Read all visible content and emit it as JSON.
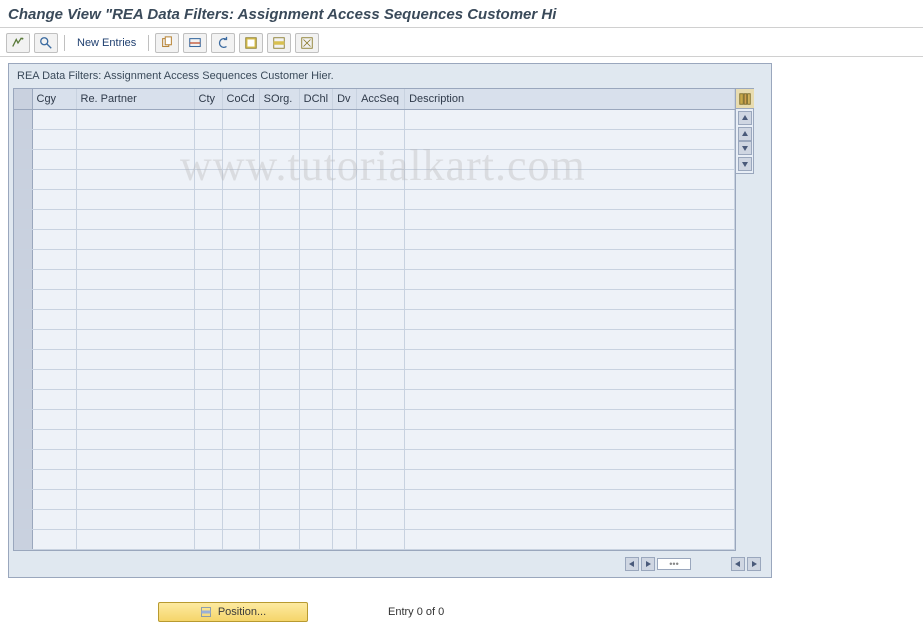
{
  "title": "Change View \"REA Data Filters: Assignment Access Sequences Customer Hi",
  "toolbar": {
    "new_entries_label": "New Entries"
  },
  "panel": {
    "title": "REA Data Filters: Assignment Access Sequences Customer Hier."
  },
  "columns": {
    "cgy": "Cgy",
    "partner": "Re. Partner",
    "cty": "Cty",
    "cocd": "CoCd",
    "sorg": "SOrg.",
    "dchl": "DChl",
    "dv": "Dv",
    "accseq": "AccSeq",
    "desc": "Description"
  },
  "rows": [],
  "footer": {
    "position_label": "Position...",
    "entry_status": "Entry 0 of 0"
  },
  "watermark": "www.tutorialkart.com"
}
